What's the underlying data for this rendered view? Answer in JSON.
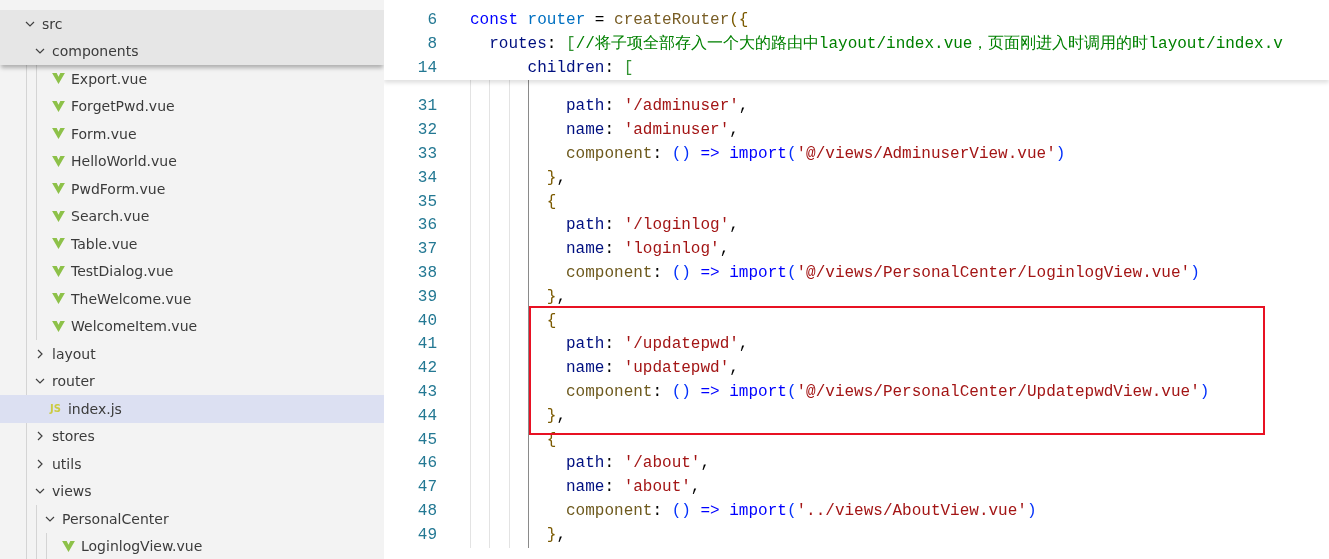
{
  "explorer": {
    "tree": [
      {
        "label": "src",
        "kind": "folder",
        "expanded": true,
        "selected": false,
        "sticky": true,
        "children": [
          {
            "label": "components",
            "kind": "folder",
            "expanded": true,
            "selected": false,
            "sticky": true,
            "children": [
              {
                "label": "Export.vue",
                "kind": "vue",
                "selected": false,
                "sticky": false
              },
              {
                "label": "ForgetPwd.vue",
                "kind": "vue",
                "selected": false,
                "sticky": false
              },
              {
                "label": "Form.vue",
                "kind": "vue",
                "selected": false,
                "sticky": false
              },
              {
                "label": "HelloWorld.vue",
                "kind": "vue",
                "selected": false,
                "sticky": false
              },
              {
                "label": "PwdForm.vue",
                "kind": "vue",
                "selected": false,
                "sticky": false
              },
              {
                "label": "Search.vue",
                "kind": "vue",
                "selected": false,
                "sticky": false
              },
              {
                "label": "Table.vue",
                "kind": "vue",
                "selected": false,
                "sticky": false
              },
              {
                "label": "TestDialog.vue",
                "kind": "vue",
                "selected": false,
                "sticky": false
              },
              {
                "label": "TheWelcome.vue",
                "kind": "vue",
                "selected": false,
                "sticky": false
              },
              {
                "label": "WelcomeItem.vue",
                "kind": "vue",
                "selected": false,
                "sticky": false
              }
            ]
          },
          {
            "label": "layout",
            "kind": "folder",
            "expanded": false,
            "selected": false,
            "sticky": false
          },
          {
            "label": "router",
            "kind": "folder",
            "expanded": true,
            "selected": false,
            "sticky": false,
            "children": [
              {
                "label": "index.js",
                "kind": "js",
                "badge": "JS",
                "selected": true,
                "sticky": false
              }
            ]
          },
          {
            "label": "stores",
            "kind": "folder",
            "expanded": false,
            "selected": false,
            "sticky": false
          },
          {
            "label": "utils",
            "kind": "folder",
            "expanded": false,
            "selected": false,
            "sticky": false
          },
          {
            "label": "views",
            "kind": "folder",
            "expanded": true,
            "selected": false,
            "sticky": false,
            "children": [
              {
                "label": "PersonalCenter",
                "kind": "folder",
                "expanded": true,
                "selected": false,
                "sticky": false,
                "children": [
                  {
                    "label": "LoginlogView.vue",
                    "kind": "vue",
                    "selected": false,
                    "sticky": false
                  }
                ]
              }
            ]
          }
        ]
      }
    ]
  },
  "editor": {
    "sticky_lines": [
      {
        "number": "6",
        "tokens": [
          {
            "text": "const",
            "kind": "keyword"
          },
          {
            "text": " router",
            "kind": "const"
          },
          {
            "text": " = "
          },
          {
            "text": "createRouter",
            "kind": "func"
          },
          {
            "text": "({",
            "kind": "brace"
          }
        ]
      },
      {
        "number": "8",
        "tokens": [
          {
            "text": "  routes",
            "kind": "prop"
          },
          {
            "text": ": "
          },
          {
            "text": "[",
            "kind": "bracket"
          },
          {
            "text": "//将子项全部存入一个大的路由中layout/index.vue，页面刚进入时调用的时layout/index.v",
            "kind": "comment"
          }
        ]
      },
      {
        "number": "14",
        "tokens": [
          {
            "text": "      children",
            "kind": "prop"
          },
          {
            "text": ": "
          },
          {
            "text": "[",
            "kind": "bracket"
          }
        ]
      }
    ],
    "lines": [
      {
        "number": "31",
        "boxed": false,
        "tokens": [
          {
            "text": "          path",
            "kind": "prop"
          },
          {
            "text": ": "
          },
          {
            "text": "'/adminuser'",
            "kind": "string"
          },
          {
            "text": ","
          }
        ]
      },
      {
        "number": "32",
        "boxed": false,
        "tokens": [
          {
            "text": "          name",
            "kind": "prop"
          },
          {
            "text": ": "
          },
          {
            "text": "'adminuser'",
            "kind": "string"
          },
          {
            "text": ","
          }
        ]
      },
      {
        "number": "33",
        "boxed": false,
        "tokens": [
          {
            "text": "          component",
            "kind": "method"
          },
          {
            "text": ": "
          },
          {
            "text": "()",
            "kind": "paren"
          },
          {
            "text": " =>",
            "kind": "keyword"
          },
          {
            "text": " import",
            "kind": "keyword"
          },
          {
            "text": "(",
            "kind": "paren"
          },
          {
            "text": "'@/views/AdminuserView.vue'",
            "kind": "string"
          },
          {
            "text": ")",
            "kind": "paren"
          }
        ]
      },
      {
        "number": "34",
        "boxed": false,
        "tokens": [
          {
            "text": "        }",
            "kind": "brace"
          },
          {
            "text": ","
          }
        ]
      },
      {
        "number": "35",
        "boxed": false,
        "tokens": [
          {
            "text": "        {",
            "kind": "brace"
          }
        ]
      },
      {
        "number": "36",
        "boxed": false,
        "tokens": [
          {
            "text": "          path",
            "kind": "prop"
          },
          {
            "text": ": "
          },
          {
            "text": "'/loginlog'",
            "kind": "string"
          },
          {
            "text": ","
          }
        ]
      },
      {
        "number": "37",
        "boxed": false,
        "tokens": [
          {
            "text": "          name",
            "kind": "prop"
          },
          {
            "text": ": "
          },
          {
            "text": "'loginlog'",
            "kind": "string"
          },
          {
            "text": ","
          }
        ]
      },
      {
        "number": "38",
        "boxed": false,
        "tokens": [
          {
            "text": "          component",
            "kind": "method"
          },
          {
            "text": ": "
          },
          {
            "text": "()",
            "kind": "paren"
          },
          {
            "text": " =>",
            "kind": "keyword"
          },
          {
            "text": " import",
            "kind": "keyword"
          },
          {
            "text": "(",
            "kind": "paren"
          },
          {
            "text": "'@/views/PersonalCenter/LoginlogView.vue'",
            "kind": "string"
          },
          {
            "text": ")",
            "kind": "paren"
          }
        ]
      },
      {
        "number": "39",
        "boxed": false,
        "tokens": [
          {
            "text": "        }",
            "kind": "brace"
          },
          {
            "text": ","
          }
        ]
      },
      {
        "number": "40",
        "boxed": true,
        "tokens": [
          {
            "text": "        {",
            "kind": "brace"
          }
        ]
      },
      {
        "number": "41",
        "boxed": true,
        "tokens": [
          {
            "text": "          path",
            "kind": "prop"
          },
          {
            "text": ": "
          },
          {
            "text": "'/updatepwd'",
            "kind": "string"
          },
          {
            "text": ","
          }
        ]
      },
      {
        "number": "42",
        "boxed": true,
        "tokens": [
          {
            "text": "          name",
            "kind": "prop"
          },
          {
            "text": ": "
          },
          {
            "text": "'updatepwd'",
            "kind": "string"
          },
          {
            "text": ","
          }
        ]
      },
      {
        "number": "43",
        "boxed": true,
        "tokens": [
          {
            "text": "          component",
            "kind": "method"
          },
          {
            "text": ": "
          },
          {
            "text": "()",
            "kind": "paren"
          },
          {
            "text": " =>",
            "kind": "keyword"
          },
          {
            "text": " import",
            "kind": "keyword"
          },
          {
            "text": "(",
            "kind": "paren"
          },
          {
            "text": "'@/views/PersonalCenter/UpdatepwdView.vue'",
            "kind": "string"
          },
          {
            "text": ")",
            "kind": "paren"
          }
        ]
      },
      {
        "number": "44",
        "boxed": true,
        "tokens": [
          {
            "text": "        }",
            "kind": "brace"
          },
          {
            "text": ","
          }
        ]
      },
      {
        "number": "45",
        "boxed": false,
        "tokens": [
          {
            "text": "        {",
            "kind": "brace"
          }
        ]
      },
      {
        "number": "46",
        "boxed": false,
        "tokens": [
          {
            "text": "          path",
            "kind": "prop"
          },
          {
            "text": ": "
          },
          {
            "text": "'/about'",
            "kind": "string"
          },
          {
            "text": ","
          }
        ]
      },
      {
        "number": "47",
        "boxed": false,
        "tokens": [
          {
            "text": "          name",
            "kind": "prop"
          },
          {
            "text": ": "
          },
          {
            "text": "'about'",
            "kind": "string"
          },
          {
            "text": ","
          }
        ]
      },
      {
        "number": "48",
        "boxed": false,
        "tokens": [
          {
            "text": "          component",
            "kind": "method"
          },
          {
            "text": ": "
          },
          {
            "text": "()",
            "kind": "paren"
          },
          {
            "text": " =>",
            "kind": "keyword"
          },
          {
            "text": " import",
            "kind": "keyword"
          },
          {
            "text": "(",
            "kind": "paren"
          },
          {
            "text": "'../views/AboutView.vue'",
            "kind": "string"
          },
          {
            "text": ")",
            "kind": "paren"
          }
        ]
      },
      {
        "number": "49",
        "boxed": false,
        "tokens": [
          {
            "text": "        }",
            "kind": "brace"
          },
          {
            "text": ","
          }
        ]
      }
    ]
  }
}
